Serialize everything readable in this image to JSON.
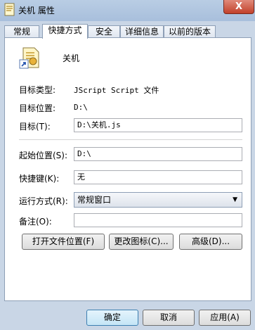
{
  "window": {
    "title": "关机 属性",
    "close_glyph": "X"
  },
  "tabs": [
    {
      "label": "常规"
    },
    {
      "label": "快捷方式"
    },
    {
      "label": "安全"
    },
    {
      "label": "详细信息"
    },
    {
      "label": "以前的版本"
    }
  ],
  "shortcut": {
    "name": "关机",
    "target_type_label": "目标类型:",
    "target_type_value": "JScript Script 文件",
    "target_location_label": "目标位置:",
    "target_location_value": "D:\\",
    "target_label": "目标(T):",
    "target_value": "D:\\关机.js",
    "start_in_label": "起始位置(S):",
    "start_in_value": "D:\\",
    "hotkey_label": "快捷键(K):",
    "hotkey_value": "无",
    "run_label": "运行方式(R):",
    "run_value": "常规窗口",
    "comment_label": "备注(O):",
    "comment_value": "",
    "open_location_button": "打开文件位置(F)",
    "change_icon_button": "更改图标(C)...",
    "advanced_button": "高级(D)..."
  },
  "footer": {
    "ok": "确定",
    "cancel": "取消",
    "apply": "应用(A)"
  }
}
